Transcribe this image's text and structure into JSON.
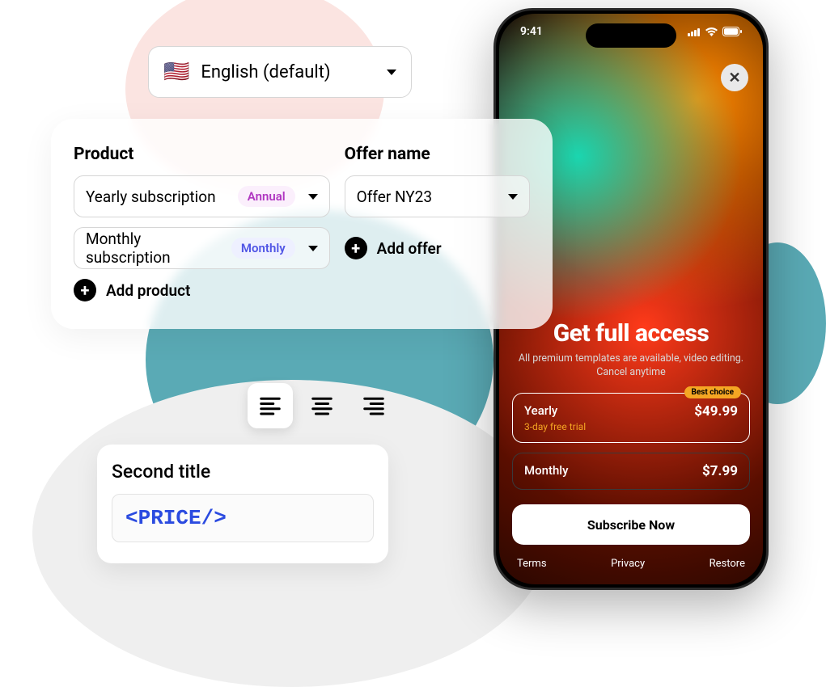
{
  "language": {
    "flag": "🇺🇸",
    "label": "English (default)"
  },
  "panel": {
    "product_header": "Product",
    "offer_header": "Offer name",
    "products": [
      {
        "label": "Yearly subscription",
        "badge": "Annual",
        "badge_kind": "annual"
      },
      {
        "label": "Monthly subscription",
        "badge": "Monthly",
        "badge_kind": "monthly"
      }
    ],
    "offers": [
      {
        "label": "Offer NY23"
      }
    ],
    "add_product": "Add product",
    "add_offer": "Add offer"
  },
  "align": {
    "active": "left"
  },
  "title_card": {
    "header": "Second title",
    "value": "<PRICE/>"
  },
  "phone": {
    "status": {
      "time": "9:41"
    },
    "paywall": {
      "headline": "Get full access",
      "subline": "All premium templates are available, video editing. Cancel anytime",
      "plans": [
        {
          "name": "Yearly",
          "trial": "3-day free trial",
          "price": "$49.99",
          "badge": "Best choice",
          "selected": true
        },
        {
          "name": "Monthly",
          "trial": "",
          "price": "$7.99",
          "badge": "",
          "selected": false
        }
      ],
      "cta": "Subscribe Now",
      "links": {
        "terms": "Terms",
        "privacy": "Privacy",
        "restore": "Restore"
      }
    }
  }
}
